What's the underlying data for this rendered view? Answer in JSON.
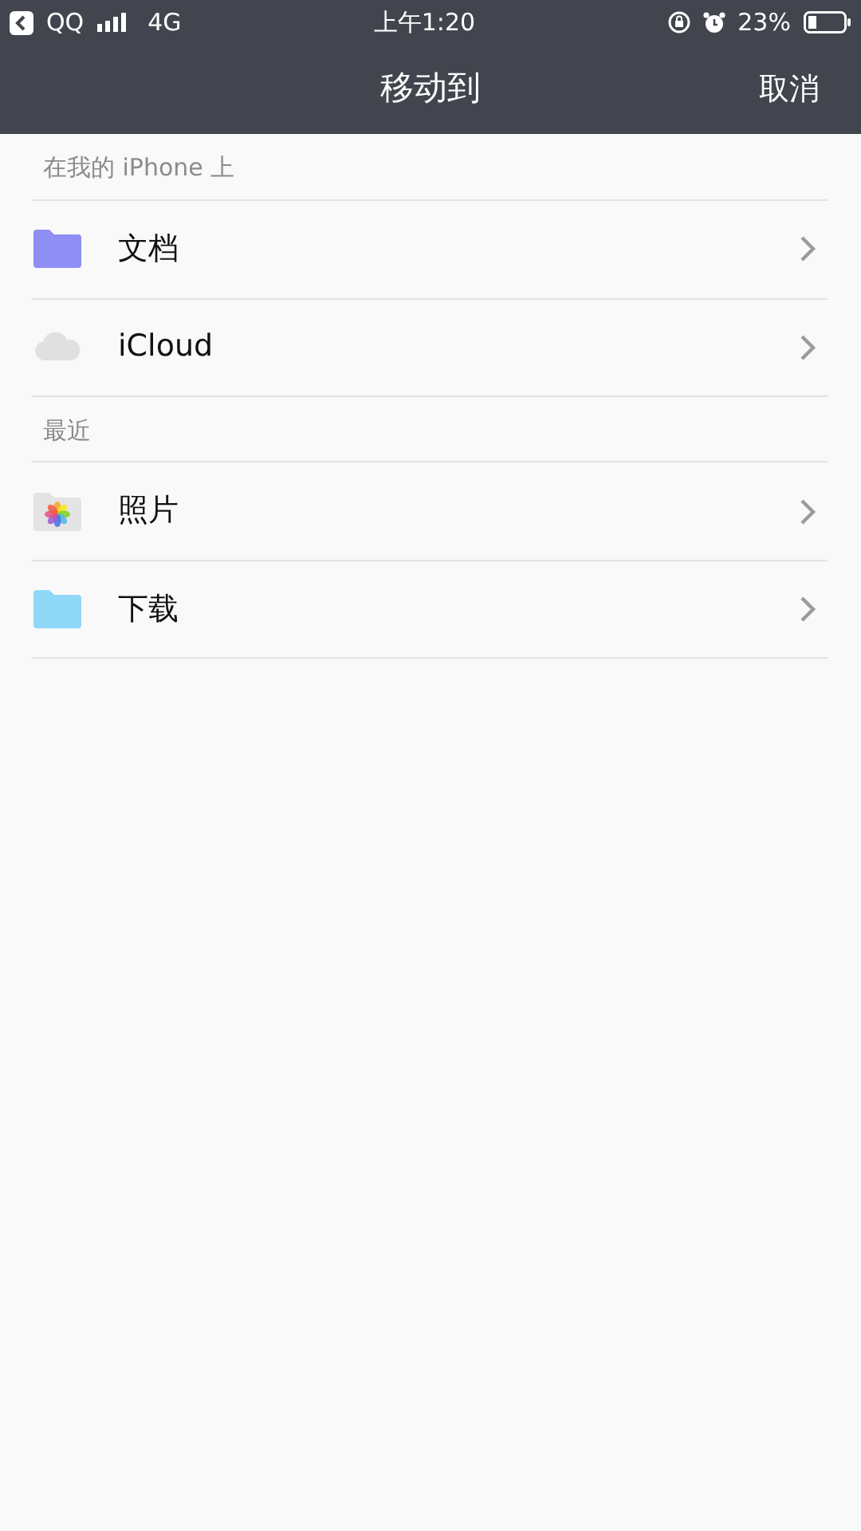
{
  "status_bar": {
    "back_app": "QQ",
    "network": "4G",
    "time": "上午1:20",
    "battery": "23%"
  },
  "nav": {
    "title": "移动到",
    "cancel": "取消"
  },
  "sections": [
    {
      "header": "在我的 iPhone 上",
      "items": [
        {
          "label": "文档",
          "kind": "folder",
          "color": "#8e8ef5"
        },
        {
          "label": "iCloud",
          "kind": "cloud"
        }
      ]
    },
    {
      "header": "最近",
      "items": [
        {
          "label": "照片",
          "kind": "photos"
        },
        {
          "label": "下载",
          "kind": "folder",
          "color": "#8fd8f8"
        }
      ]
    }
  ]
}
